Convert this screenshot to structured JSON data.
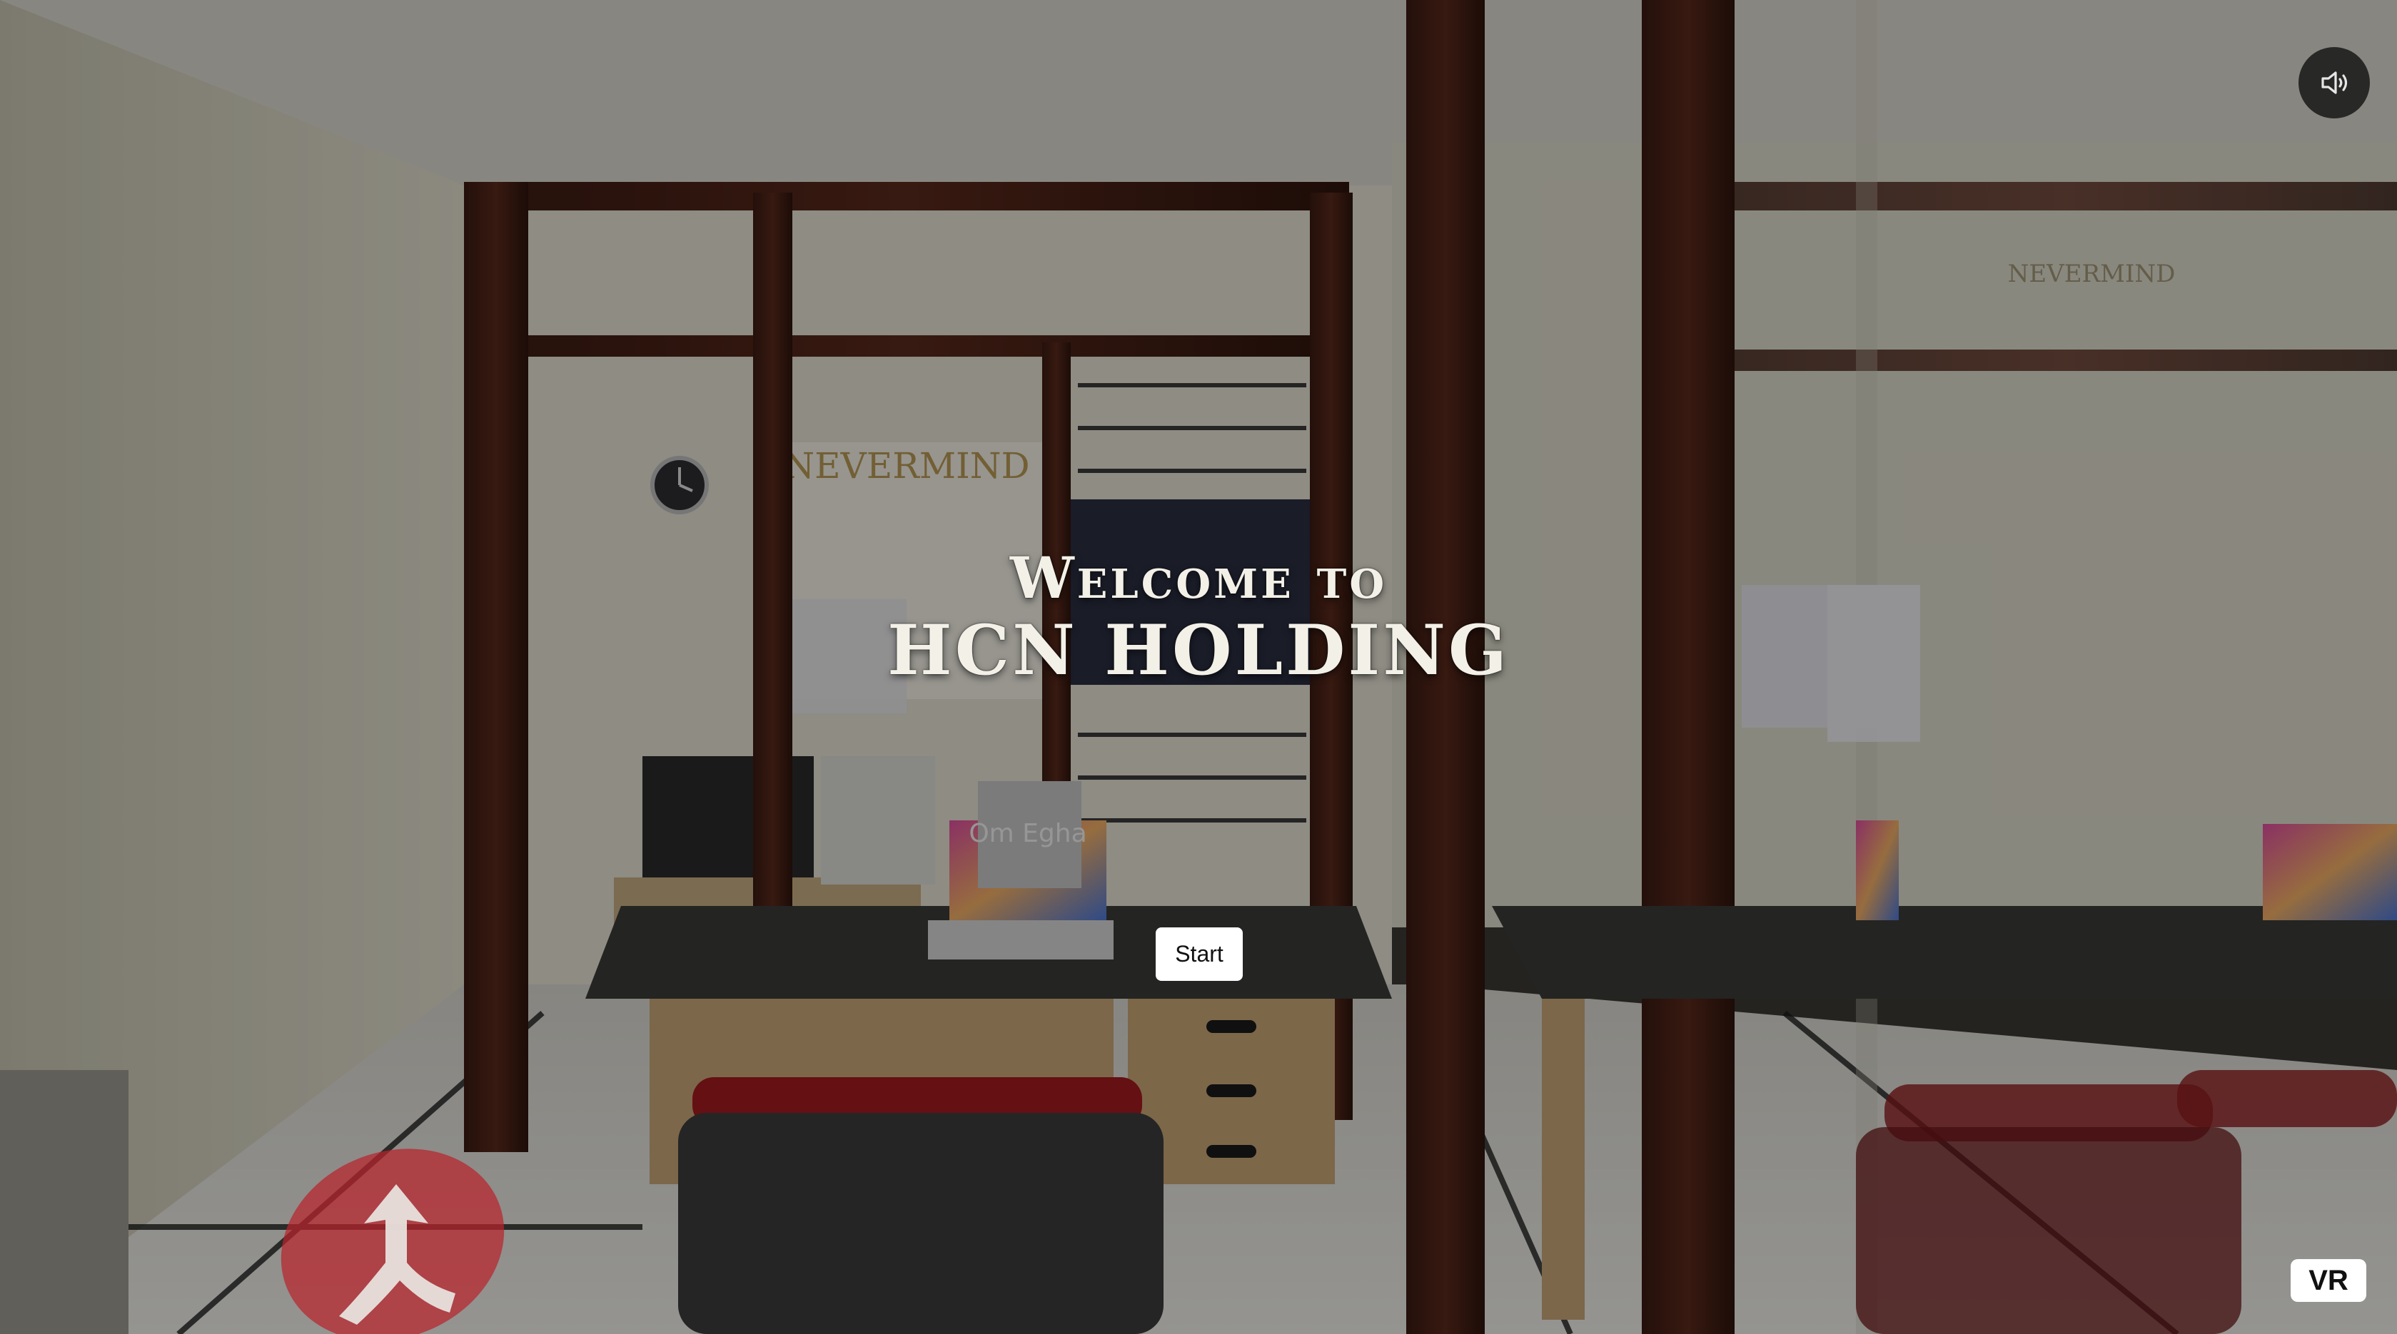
{
  "welcome": {
    "line1": "Welcome to",
    "line2": "HCN HOLDING"
  },
  "controls": {
    "start_label": "Start",
    "vr_label": "VR",
    "sound_icon": "speaker-volume-icon",
    "hotspot_icon": "navigation-arrow-icon"
  },
  "scene": {
    "wall_sign_text": "NEVERMIND",
    "screen_text": "Om Egha"
  },
  "colors": {
    "overlay": "#000000",
    "button_bg": "#ffffff",
    "hotspot": "#b8242c",
    "chair_red": "#a31a1f"
  }
}
